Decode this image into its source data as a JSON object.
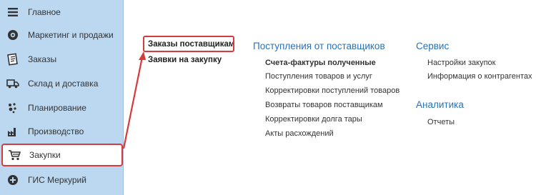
{
  "sidebar": {
    "items": [
      {
        "label": "Главное",
        "icon": "menu-icon"
      },
      {
        "label": "Маркетинг и продажи",
        "icon": "marketing-icon"
      },
      {
        "label": "Заказы",
        "icon": "orders-icon"
      },
      {
        "label": "Склад и доставка",
        "icon": "truck-icon"
      },
      {
        "label": "Планирование",
        "icon": "planning-icon"
      },
      {
        "label": "Производство",
        "icon": "factory-icon"
      },
      {
        "label": "Закупки",
        "icon": "cart-icon",
        "active": true
      },
      {
        "label": "ГИС Меркурий",
        "icon": "mercury-icon"
      }
    ]
  },
  "main": {
    "quick_links": [
      "Заказы поставщикам",
      "Заявки на закупку"
    ],
    "receipts": {
      "title": "Поступления от поставщиков",
      "items": [
        "Счета-фактуры полученные",
        "Поступления товаров и услуг",
        "Корректировки поступлений товаров",
        "Возвраты товаров поставщикам",
        "Корректировки долга тары",
        "Акты расхождений"
      ]
    },
    "service": {
      "title": "Сервис",
      "items": [
        "Настройки закупок",
        "Информация о контрагентах"
      ]
    },
    "analytics": {
      "title": "Аналитика",
      "items": [
        "Отчеты"
      ]
    }
  },
  "colors": {
    "sidebar_bg": "#bcd8f1",
    "highlight": "#d63a3a",
    "section_title": "#2a72b5"
  }
}
